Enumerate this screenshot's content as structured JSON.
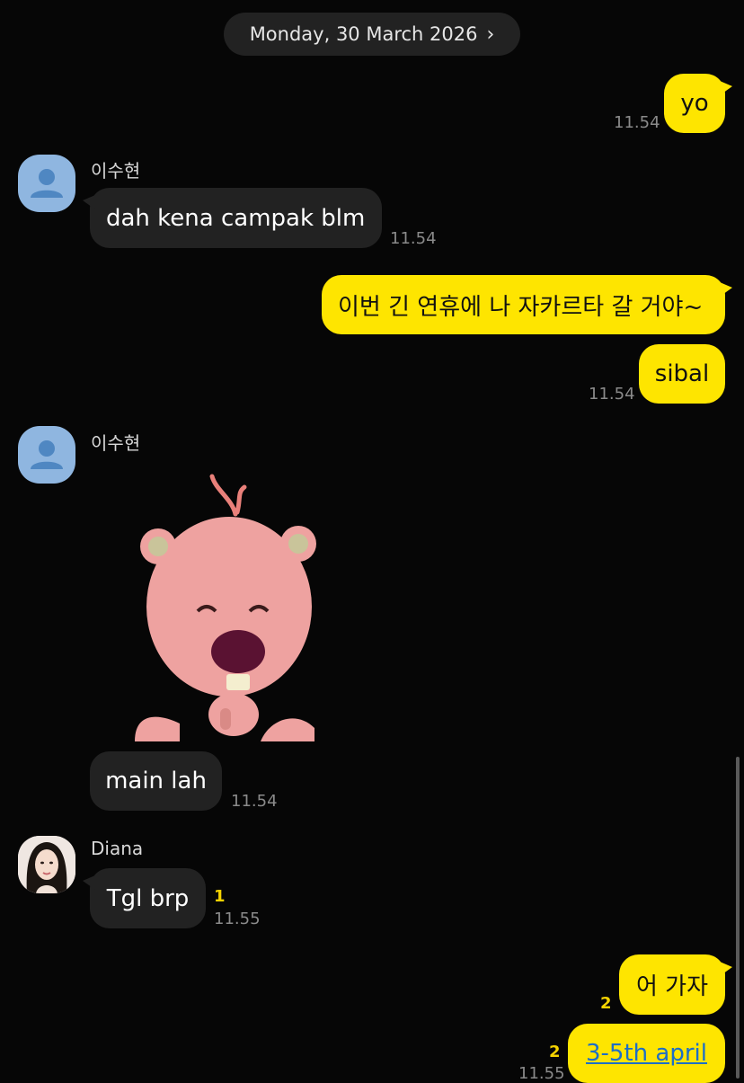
{
  "header": {
    "date": "Monday, 30 March 2026",
    "date_icon": "chevron-right-icon"
  },
  "contacts": {
    "su": "이수현",
    "diana": "Diana"
  },
  "messages": {
    "m1": {
      "text": "yo",
      "time": "11.54"
    },
    "m2": {
      "text": "dah kena campak blm",
      "time": "11.54"
    },
    "m3": {
      "text": "이번 긴 연휴에 나 자카르타 갈 거야~"
    },
    "m4": {
      "text": "sibal",
      "time": "11.54"
    },
    "m5": {
      "sticker": "pink-beaver-sticker"
    },
    "m6": {
      "text": "main lah",
      "time": "11.54"
    },
    "m7": {
      "text": "Tgl brp",
      "unread": "1",
      "time": "11.55"
    },
    "m8": {
      "text": "어 가자",
      "unread": "2"
    },
    "m9": {
      "text": "3-5th april",
      "unread": "2",
      "time": "11.55"
    }
  },
  "colors": {
    "my_bubble": "#fee500",
    "their_bubble": "#222222",
    "background": "#060606",
    "link": "#1d6ec7"
  }
}
